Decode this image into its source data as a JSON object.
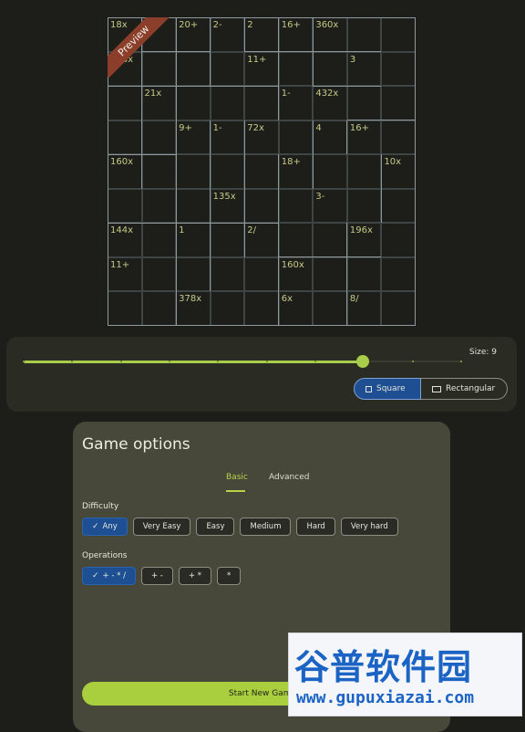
{
  "preview": {
    "ribbon_label": "Preview",
    "grid_size": 9,
    "clues": [
      {
        "row": 0,
        "col": 0,
        "text": "18x"
      },
      {
        "row": 0,
        "col": 2,
        "text": "20+"
      },
      {
        "row": 0,
        "col": 3,
        "text": "2-"
      },
      {
        "row": 0,
        "col": 4,
        "text": "2"
      },
      {
        "row": 0,
        "col": 5,
        "text": "16+"
      },
      {
        "row": 0,
        "col": 6,
        "text": "360x"
      },
      {
        "row": 1,
        "col": 0,
        "text": "378x"
      },
      {
        "row": 1,
        "col": 4,
        "text": "11+"
      },
      {
        "row": 1,
        "col": 7,
        "text": "3"
      },
      {
        "row": 2,
        "col": 1,
        "text": "21x"
      },
      {
        "row": 2,
        "col": 5,
        "text": "1-"
      },
      {
        "row": 2,
        "col": 6,
        "text": "432x"
      },
      {
        "row": 3,
        "col": 2,
        "text": "9+"
      },
      {
        "row": 3,
        "col": 3,
        "text": "1-"
      },
      {
        "row": 3,
        "col": 4,
        "text": "72x"
      },
      {
        "row": 3,
        "col": 6,
        "text": "4"
      },
      {
        "row": 3,
        "col": 7,
        "text": "16+"
      },
      {
        "row": 4,
        "col": 0,
        "text": "160x"
      },
      {
        "row": 4,
        "col": 5,
        "text": "18+"
      },
      {
        "row": 4,
        "col": 8,
        "text": "10x"
      },
      {
        "row": 5,
        "col": 3,
        "text": "135x"
      },
      {
        "row": 5,
        "col": 6,
        "text": "3-"
      },
      {
        "row": 6,
        "col": 0,
        "text": "144x"
      },
      {
        "row": 6,
        "col": 2,
        "text": "1"
      },
      {
        "row": 6,
        "col": 4,
        "text": "2/"
      },
      {
        "row": 6,
        "col": 7,
        "text": "196x"
      },
      {
        "row": 7,
        "col": 0,
        "text": "11+"
      },
      {
        "row": 7,
        "col": 5,
        "text": "160x"
      },
      {
        "row": 8,
        "col": 2,
        "text": "378x"
      },
      {
        "row": 8,
        "col": 5,
        "text": "6x"
      },
      {
        "row": 8,
        "col": 7,
        "text": "8/"
      }
    ]
  },
  "size_control": {
    "label": "Size: 9",
    "slider_value_fraction": 0.78,
    "tick_count": 10,
    "shape_options": [
      {
        "label": "Square",
        "selected": true
      },
      {
        "label": "Rectangular",
        "selected": false
      }
    ]
  },
  "game_options": {
    "title": "Game options",
    "tabs": [
      {
        "label": "Basic",
        "selected": true
      },
      {
        "label": "Advanced",
        "selected": false
      }
    ],
    "difficulty": {
      "label": "Difficulty",
      "options": [
        {
          "label": "Any",
          "selected": true
        },
        {
          "label": "Very Easy",
          "selected": false
        },
        {
          "label": "Easy",
          "selected": false
        },
        {
          "label": "Medium",
          "selected": false
        },
        {
          "label": "Hard",
          "selected": false
        },
        {
          "label": "Very hard",
          "selected": false
        }
      ]
    },
    "operations": {
      "label": "Operations",
      "options": [
        {
          "label": "+ - * /",
          "selected": true
        },
        {
          "label": "+ -",
          "selected": false
        },
        {
          "label": "+ *",
          "selected": false
        },
        {
          "label": "*",
          "selected": false
        }
      ]
    },
    "start_button": "Start New Game"
  },
  "watermark": {
    "cn_text": "谷普软件园",
    "url_text": "www.gupuxiazai.com"
  },
  "colors": {
    "background": "#1d1e1a",
    "accent_green": "#a9cc4a",
    "selected_blue": "#1d4f92",
    "clue_text": "#c6cb86",
    "ribbon": "#8b3f2a"
  }
}
